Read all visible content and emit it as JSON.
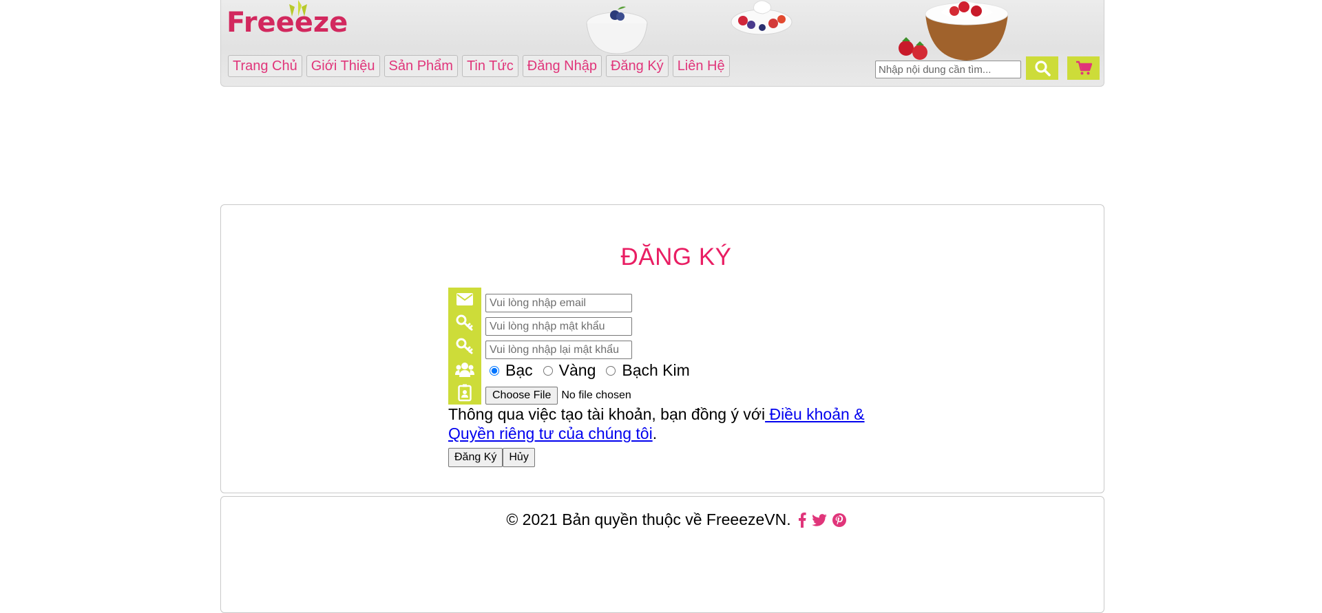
{
  "header": {
    "logo": "Freeeze",
    "nav": [
      {
        "label": "Trang Chủ"
      },
      {
        "label": "Giới Thiệu"
      },
      {
        "label": "Sản Phẩm"
      },
      {
        "label": "Tin Tức"
      },
      {
        "label": "Đăng Nhập"
      },
      {
        "label": "Đăng Ký"
      },
      {
        "label": "Liên Hệ"
      }
    ],
    "search_placeholder": "Nhập nội dung cần tìm...",
    "icons": {
      "search": "search-icon",
      "cart": "cart-icon"
    },
    "accent_color": "#cddc39",
    "nav_color": "#e0357a"
  },
  "form": {
    "title": "ĐĂNG KÝ",
    "email_placeholder": "Vui lòng nhập email",
    "password_placeholder": "Vui lòng nhập mật khẩu",
    "confirm_placeholder": "Vui lòng nhập lại mật khẩu",
    "tiers": [
      "Bạc",
      "Vàng",
      "Bạch Kim"
    ],
    "selected_tier": "Bạc",
    "file_button": "Choose File",
    "file_status": "No file chosen",
    "terms_text": "Thông qua việc tạo tài khoản, bạn đồng ý với",
    "terms_link": " Điều khoản & Quyền riêng tư của chúng tôi",
    "terms_end": ".",
    "submit_label": "Đăng Ký",
    "cancel_label": "Hủy",
    "icons": [
      "envelope-icon",
      "key-icon",
      "key-icon",
      "group-icon",
      "id-badge-icon"
    ],
    "title_color": "#e91e63"
  },
  "footer": {
    "copyright": "© 2021 Bản quyền thuộc về FreeezeVN.",
    "social_icons": [
      "facebook-icon",
      "twitter-icon",
      "pinterest-icon"
    ],
    "social_color": "#e0357a"
  }
}
